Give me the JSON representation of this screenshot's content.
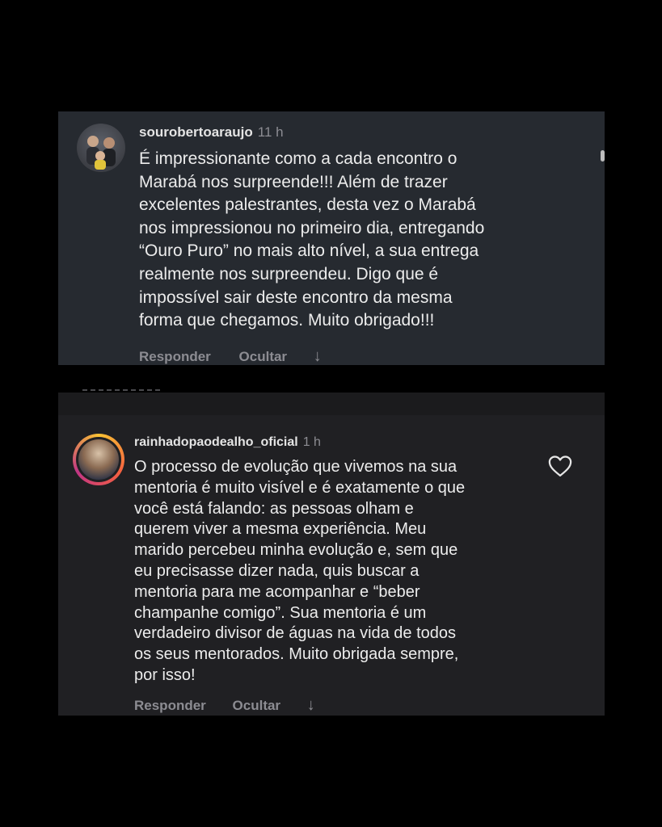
{
  "comments": [
    {
      "username": "sourobertoaraujo",
      "time": "11 h",
      "text_lines": [
        "É impressionante como a cada encontro o",
        "Marabá nos surpreende!!! Além de trazer",
        "excelentes palestrantes, desta vez o Marabá",
        "nos impressionou no primeiro dia, entregando",
        "“Ouro Puro” no mais alto nível,  a sua entrega",
        "realmente nos surpreendeu. Digo que é",
        "impossível sair deste encontro da mesma",
        "forma que chegamos. Muito obrigado!!!"
      ],
      "reply_label": "Responder",
      "hide_label": "Ocultar",
      "arrow_icon": "↓"
    },
    {
      "username": "rainhadopaodealho_oficial",
      "time": "1 h",
      "text_lines": [
        "O processo de evolução que vivemos na sua",
        "mentoria é muito visível e é exatamente o que",
        "você está falando: as pessoas olham e",
        "querem viver a mesma experiência. Meu",
        "marido percebeu minha evolução e, sem que",
        "eu precisasse dizer nada, quis buscar a",
        "mentoria para me acompanhar e “beber",
        "champanhe comigo”. Sua mentoria é um",
        "verdadeiro divisor de águas na vida de todos",
        "os seus mentorados. Muito obrigada sempre,",
        "por isso!"
      ],
      "reply_label": "Responder",
      "hide_label": "Ocultar",
      "arrow_icon": "↓",
      "like_icon": "heart-icon"
    }
  ],
  "colors": {
    "page_background": "#000000",
    "card1_background": "#262a30",
    "card2_background": "#202023",
    "muted_text": "#8c8c92",
    "story_ring": [
      "#f9c233",
      "#f56040",
      "#c13584"
    ]
  }
}
